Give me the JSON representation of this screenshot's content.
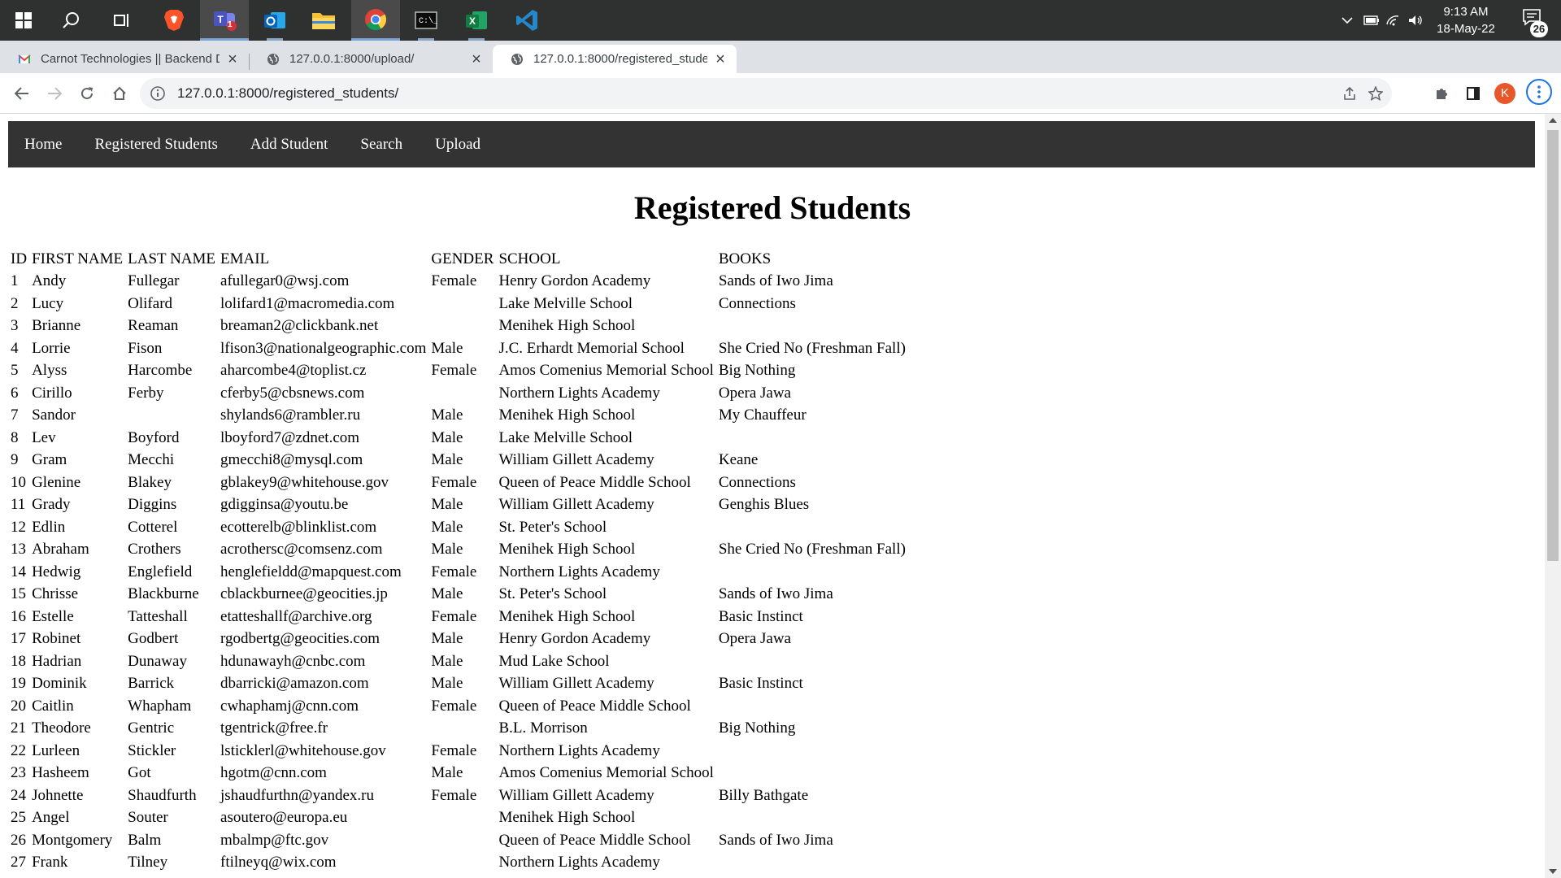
{
  "taskbar": {
    "time": "9:13 AM",
    "date": "18-May-22",
    "notifications": "26",
    "teams_badge": "1",
    "colors": {
      "background": "#2f3030"
    }
  },
  "browser": {
    "tabs": [
      {
        "title": "Carnot Technologies || Backend D",
        "favicon": "gmail-icon"
      },
      {
        "title": "127.0.0.1:8000/upload/",
        "favicon": "globe-icon"
      },
      {
        "title": "127.0.0.1:8000/registered_studen",
        "favicon": "globe-icon",
        "active": true
      }
    ],
    "url": "127.0.0.1:8000/registered_students/",
    "profile_initial": "K"
  },
  "site": {
    "nav": [
      "Home",
      "Registered Students",
      "Add Student",
      "Search",
      "Upload"
    ],
    "title": "Registered Students",
    "colors": {
      "nav_background": "#333333",
      "nav_text": "#ffffff"
    }
  },
  "table": {
    "headers": [
      "ID",
      "FIRST NAME",
      "LAST NAME",
      "EMAIL",
      "GENDER",
      "SCHOOL",
      "BOOKS"
    ],
    "rows": [
      [
        "1",
        "Andy",
        "Fullegar",
        "afullegar0@wsj.com",
        "Female",
        "Henry Gordon Academy",
        "Sands of Iwo Jima"
      ],
      [
        "2",
        "Lucy",
        "Olifard",
        "lolifard1@macromedia.com",
        "",
        "Lake Melville School",
        "Connections"
      ],
      [
        "3",
        "Brianne",
        "Reaman",
        "breaman2@clickbank.net",
        "",
        "Menihek High School",
        ""
      ],
      [
        "4",
        "Lorrie",
        "Fison",
        "lfison3@nationalgeographic.com",
        "Male",
        "J.C. Erhardt Memorial School",
        "She Cried No (Freshman Fall)"
      ],
      [
        "5",
        "Alyss",
        "Harcombe",
        "aharcombe4@toplist.cz",
        "Female",
        "Amos Comenius Memorial School",
        "Big Nothing"
      ],
      [
        "6",
        "Cirillo",
        "Ferby",
        "cferby5@cbsnews.com",
        "",
        "Northern Lights Academy",
        "Opera Jawa"
      ],
      [
        "7",
        "Sandor",
        "",
        "shylands6@rambler.ru",
        "Male",
        "Menihek High School",
        "My Chauffeur"
      ],
      [
        "8",
        "Lev",
        "Boyford",
        "lboyford7@zdnet.com",
        "Male",
        "Lake Melville School",
        ""
      ],
      [
        "9",
        "Gram",
        "Mecchi",
        "gmecchi8@mysql.com",
        "Male",
        "William Gillett Academy",
        "Keane"
      ],
      [
        "10",
        "Glenine",
        "Blakey",
        "gblakey9@whitehouse.gov",
        "Female",
        "Queen of Peace Middle School",
        "Connections"
      ],
      [
        "11",
        "Grady",
        "Diggins",
        "gdigginsa@youtu.be",
        "Male",
        "William Gillett Academy",
        "Genghis Blues"
      ],
      [
        "12",
        "Edlin",
        "Cotterel",
        "ecotterelb@blinklist.com",
        "Male",
        "St. Peter's School",
        ""
      ],
      [
        "13",
        "Abraham",
        "Crothers",
        "acrothersc@comsenz.com",
        "Male",
        "Menihek High School",
        "She Cried No (Freshman Fall)"
      ],
      [
        "14",
        "Hedwig",
        "Englefield",
        "henglefieldd@mapquest.com",
        "Female",
        "Northern Lights Academy",
        ""
      ],
      [
        "15",
        "Chrisse",
        "Blackburne",
        "cblackburnee@geocities.jp",
        "Male",
        "St. Peter's School",
        "Sands of Iwo Jima"
      ],
      [
        "16",
        "Estelle",
        "Tatteshall",
        "etatteshallf@archive.org",
        "Female",
        "Menihek High School",
        "Basic Instinct"
      ],
      [
        "17",
        "Robinet",
        "Godbert",
        "rgodbertg@geocities.com",
        "Male",
        "Henry Gordon Academy",
        "Opera Jawa"
      ],
      [
        "18",
        "Hadrian",
        "Dunaway",
        "hdunawayh@cnbc.com",
        "Male",
        "Mud Lake School",
        ""
      ],
      [
        "19",
        "Dominik",
        "Barrick",
        "dbarricki@amazon.com",
        "Male",
        "William Gillett Academy",
        "Basic Instinct"
      ],
      [
        "20",
        "Caitlin",
        "Whapham",
        "cwhaphamj@cnn.com",
        "Female",
        "Queen of Peace Middle School",
        ""
      ],
      [
        "21",
        "Theodore",
        "Gentric",
        "tgentrick@free.fr",
        "",
        "B.L. Morrison",
        "Big Nothing"
      ],
      [
        "22",
        "Lurleen",
        "Stickler",
        "lsticklerl@whitehouse.gov",
        "Female",
        "Northern Lights Academy",
        ""
      ],
      [
        "23",
        "Hasheem",
        "Got",
        "hgotm@cnn.com",
        "Male",
        "Amos Comenius Memorial School",
        ""
      ],
      [
        "24",
        "Johnette",
        "Shaudfurth",
        "jshaudfurthn@yandex.ru",
        "Female",
        "William Gillett Academy",
        "Billy Bathgate"
      ],
      [
        "25",
        "Angel",
        "Souter",
        "asoutero@europa.eu",
        "",
        "Menihek High School",
        ""
      ],
      [
        "26",
        "Montgomery",
        "Balm",
        "mbalmp@ftc.gov",
        "",
        "Queen of Peace Middle School",
        "Sands of Iwo Jima"
      ],
      [
        "27",
        "Frank",
        "Tilney",
        "ftilneyq@wix.com",
        "",
        "Northern Lights Academy",
        ""
      ]
    ]
  }
}
